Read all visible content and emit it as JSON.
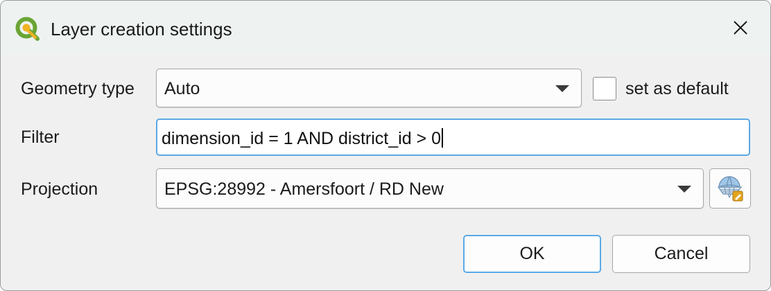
{
  "window": {
    "title": "Layer creation settings",
    "app_icon": "qgis-logo-icon",
    "close_icon": "close-icon"
  },
  "form": {
    "geometry_type": {
      "label": "Geometry type",
      "value": "Auto"
    },
    "set_as_default": {
      "label": "set as default",
      "checked": false
    },
    "filter": {
      "label": "Filter",
      "value": "dimension_id = 1 AND district_id > 0"
    },
    "projection": {
      "label": "Projection",
      "value": "EPSG:28992 - Amersfoort / RD New",
      "select_crs_icon": "globe-crs-icon"
    }
  },
  "buttons": {
    "ok_label": "OK",
    "cancel_label": "Cancel"
  },
  "colors": {
    "focus_accent": "#5aa9e6",
    "qgis_green": "#589632",
    "qgis_yellow": "#ee7913"
  }
}
